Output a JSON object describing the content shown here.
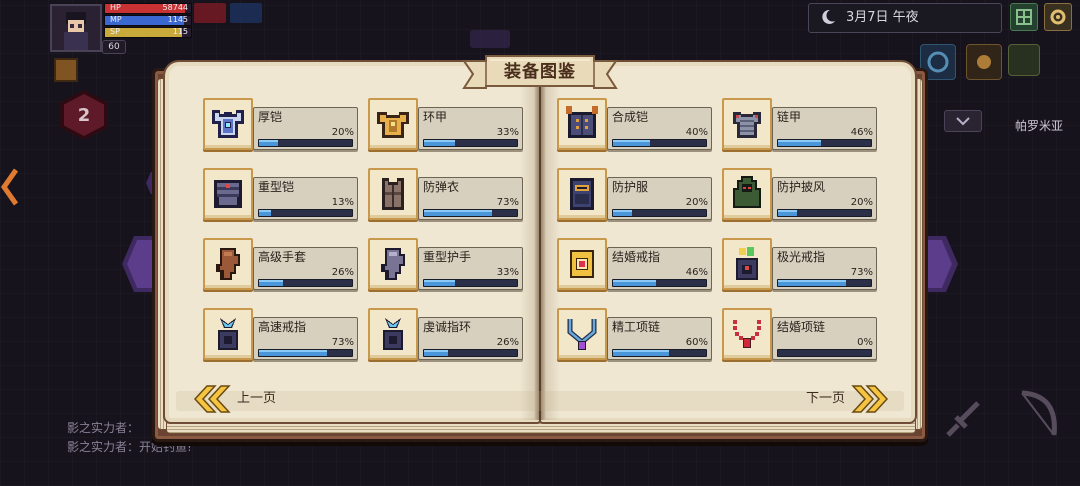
{
  "hud": {
    "hp": {
      "label": "HP",
      "value": "58744",
      "fill": 0.93
    },
    "mp": {
      "label": "MP",
      "value": "1145",
      "fill": 0.92
    },
    "sp": {
      "label": "SP",
      "value": "115",
      "fill": 0.9
    },
    "level": "60",
    "skill_badge": "2"
  },
  "clock": {
    "icon": "moon-icon",
    "text": "3月7日 午夜"
  },
  "location": {
    "name": "帕罗米亚"
  },
  "chat": {
    "lines": [
      "影之实力者：",
      "影之实力者：开始钓鱼!"
    ]
  },
  "codex": {
    "title": "装备图鉴",
    "pages": [
      {
        "items": [
          {
            "name": "厚铠",
            "percent": "20%",
            "icon": "heavy-armor-icon"
          },
          {
            "name": "环甲",
            "percent": "33%",
            "icon": "gold-armor-icon"
          },
          {
            "name": "重型铠",
            "percent": "13%",
            "icon": "heavy-plate-icon"
          },
          {
            "name": "防弹衣",
            "percent": "73%",
            "icon": "vest-icon"
          },
          {
            "name": "高级手套",
            "percent": "26%",
            "icon": "glove-icon"
          },
          {
            "name": "重型护手",
            "percent": "33%",
            "icon": "gauntlet-icon"
          },
          {
            "name": "高速戒指",
            "percent": "73%",
            "icon": "crystal-ring-icon"
          },
          {
            "name": "虔诚指环",
            "percent": "26%",
            "icon": "crystal-ring-icon"
          }
        ]
      },
      {
        "items": [
          {
            "name": "合成铠",
            "percent": "40%",
            "icon": "spiked-armor-icon"
          },
          {
            "name": "链甲",
            "percent": "46%",
            "icon": "chainmail-icon"
          },
          {
            "name": "防护服",
            "percent": "20%",
            "icon": "suit-icon"
          },
          {
            "name": "防护披风",
            "percent": "20%",
            "icon": "cloak-icon"
          },
          {
            "name": "结婚戒指",
            "percent": "46%",
            "icon": "gold-ring-icon"
          },
          {
            "name": "极光戒指",
            "percent": "73%",
            "icon": "aurora-ring-icon"
          },
          {
            "name": "精工项链",
            "percent": "60%",
            "icon": "necklace-icon"
          },
          {
            "name": "结婚项链",
            "percent": "0%",
            "icon": "bead-necklace-icon"
          }
        ]
      }
    ],
    "nav": {
      "prev_label": "上一页",
      "prev_icon": "double-chevron-left-icon",
      "next_label": "下一页",
      "next_icon": "double-chevron-right-icon"
    }
  },
  "colors": {
    "page": "#efe7d2",
    "cover": "#6b4333",
    "progress_fill": "#4a96d8",
    "progress_track": "#2b3048",
    "arrow_gold": "#f5c542",
    "hp": "#c83232",
    "mp": "#3a68d0",
    "sp": "#c9a93a"
  }
}
